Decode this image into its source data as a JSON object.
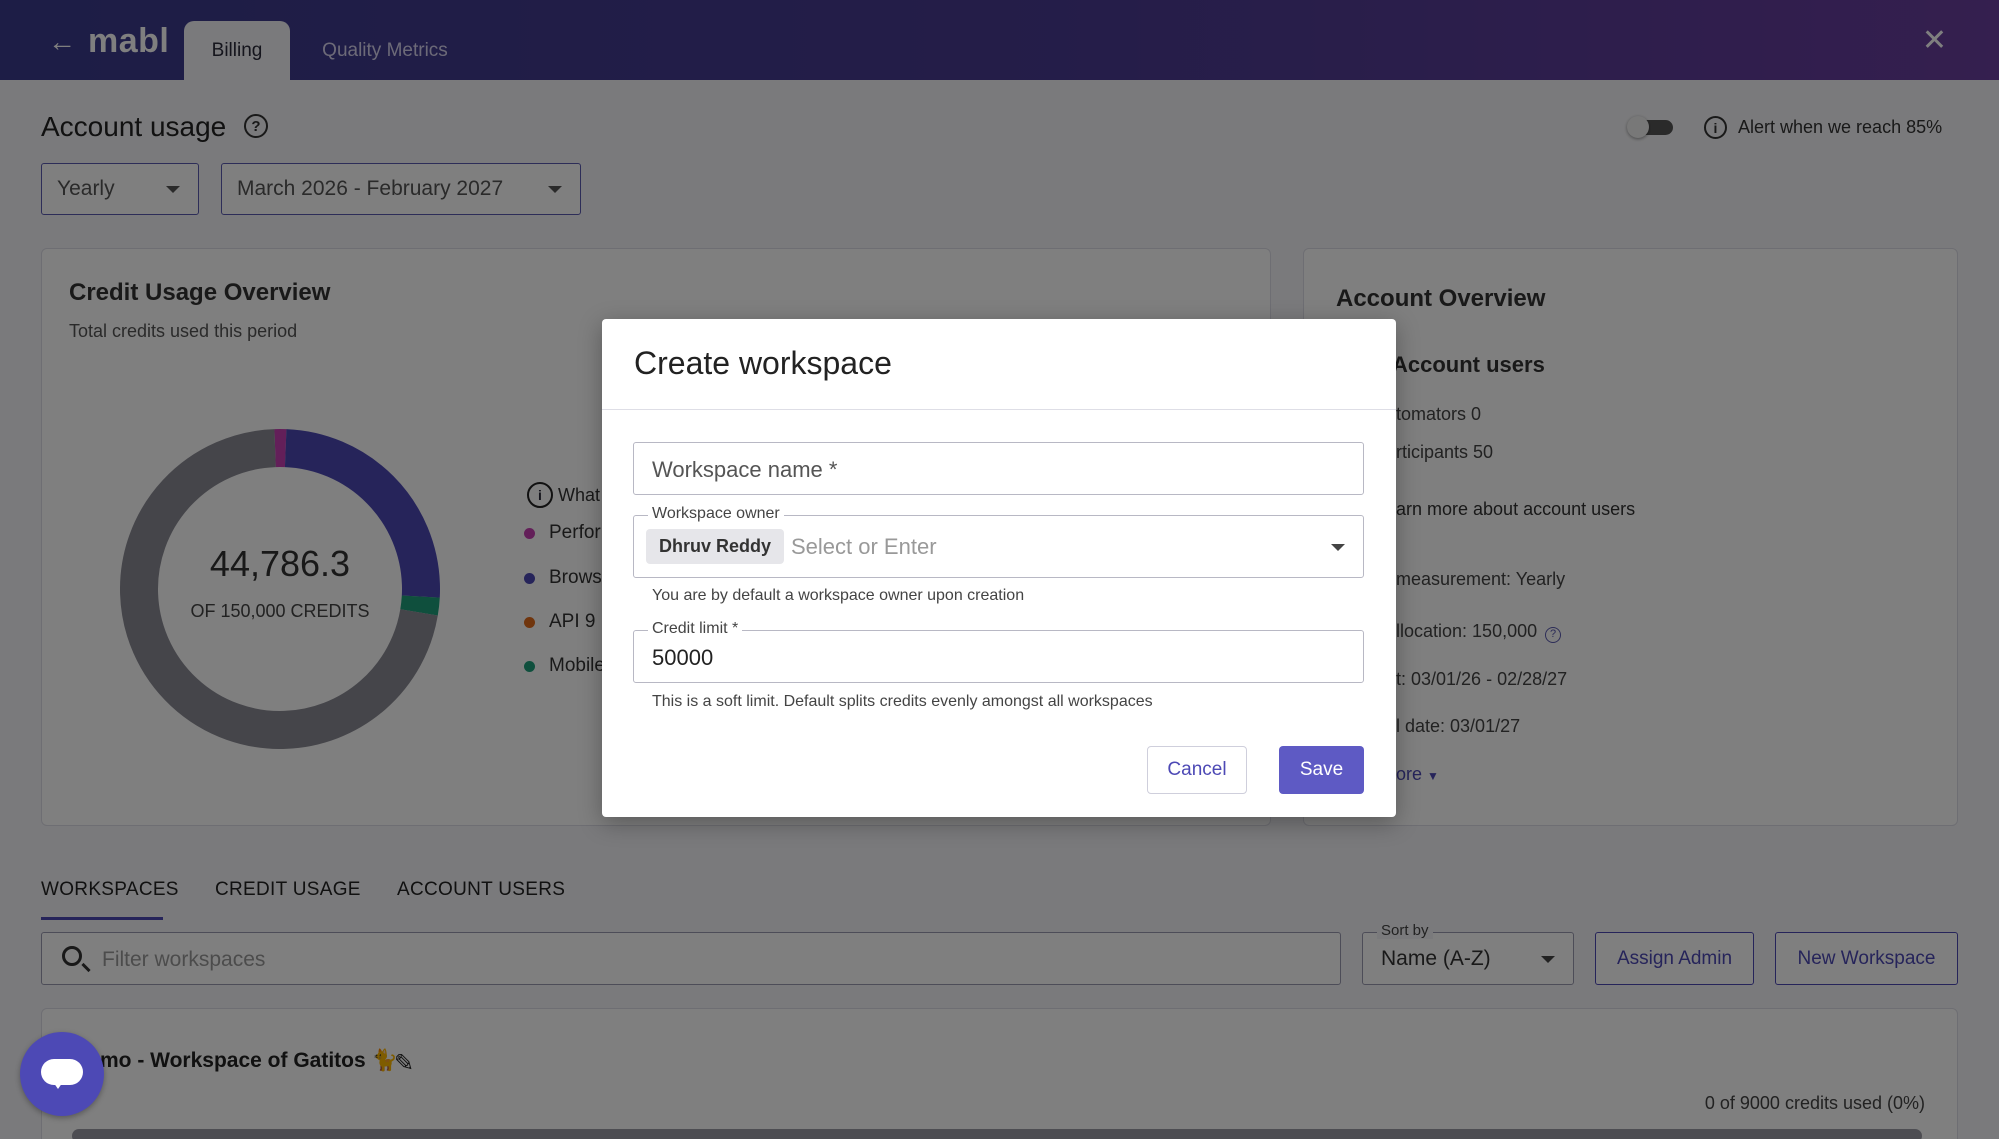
{
  "app": {
    "logo": "mabl",
    "tabs": [
      {
        "label": "Billing",
        "active": true
      },
      {
        "label": "Quality Metrics",
        "active": false
      }
    ]
  },
  "header": {
    "title": "Account usage",
    "alert_label": "Alert when we reach 85%",
    "alert_enabled": false,
    "period_select": "Yearly",
    "range_select": "March 2026 - February 2027"
  },
  "credit_card": {
    "title": "Credit Usage Overview",
    "subtitle": "Total credits used this period",
    "total": "44,786.3",
    "total_sub": "OF 150,000 CREDITS",
    "legend_heading": "What",
    "legend": [
      {
        "label": "Perfor",
        "color": "#c63fb3"
      },
      {
        "label": "Brows",
        "color": "#4d49b5"
      },
      {
        "label": "API   9",
        "color": "#e06a1b"
      },
      {
        "label": "Mobile",
        "color": "#1f9e7a"
      }
    ]
  },
  "chart_data": {
    "type": "pie",
    "segments": [
      {
        "color": "#c63fb3",
        "fraction": 0.012
      },
      {
        "color": "#4d49b5",
        "fraction": 0.252
      },
      {
        "color": "#1f9e7a",
        "fraction": 0.018
      },
      {
        "color": "#8a8a94",
        "fraction": 0.718
      }
    ]
  },
  "account_card": {
    "title": "Account Overview",
    "users_heading": "Account users",
    "automators": "tomators   0",
    "participants": "rticipants   50",
    "learn_more": "arn more about account users",
    "measurement": "measurement: Yearly",
    "allocation": "llocation: 150,000",
    "contract": "t: 03/01/26 - 02/28/27",
    "renewal": "l date: 03/01/27",
    "more": "ore"
  },
  "bottom": {
    "tabs": [
      "WORKSPACES",
      "CREDIT USAGE",
      "ACCOUNT USERS"
    ],
    "filter_placeholder": "Filter workspaces",
    "sort_label": "Sort by",
    "sort_value": "Name (A-Z)",
    "assign_admin": "Assign Admin",
    "new_workspace": "New Workspace",
    "workspace_name": "mo - Workspace of Gatitos 🐈",
    "workspace_used": "0 of 9000 credits used (0%)"
  },
  "modal": {
    "title": "Create workspace",
    "name_placeholder": "Workspace name *",
    "owner_label": "Workspace owner",
    "owner_chip": "Dhruv Reddy",
    "owner_placeholder": "Select or Enter",
    "owner_helper": "You are by default a workspace owner upon creation",
    "limit_label": "Credit limit *",
    "limit_value": "50000",
    "limit_helper": "This is a soft limit. Default splits credits evenly amongst all workspaces",
    "cancel": "Cancel",
    "save": "Save"
  }
}
